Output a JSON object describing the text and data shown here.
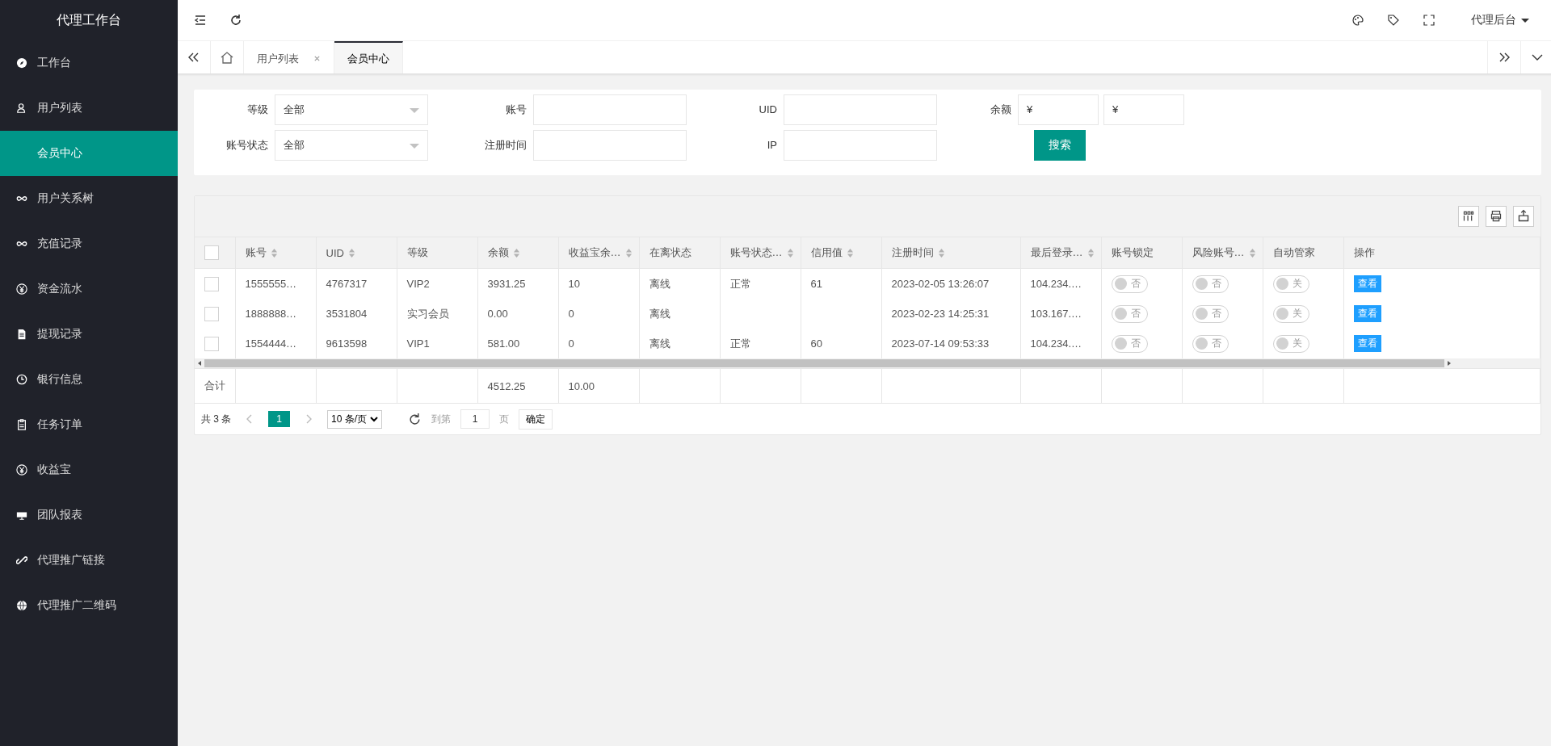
{
  "sidebar": {
    "title": "代理工作台",
    "items": [
      {
        "label": "工作台",
        "selected": false
      },
      {
        "label": "用户列表",
        "selected": false
      },
      {
        "label": "会员中心",
        "selected": true
      },
      {
        "label": "用户关系树",
        "selected": false
      },
      {
        "label": "充值记录",
        "selected": false
      },
      {
        "label": "资金流水",
        "selected": false
      },
      {
        "label": "提现记录",
        "selected": false
      },
      {
        "label": "银行信息",
        "selected": false
      },
      {
        "label": "任务订单",
        "selected": false
      },
      {
        "label": "收益宝",
        "selected": false
      },
      {
        "label": "团队报表",
        "selected": false
      },
      {
        "label": "代理推广链接",
        "selected": false
      },
      {
        "label": "代理推广二维码",
        "selected": false
      }
    ]
  },
  "topbar": {
    "user_menu": "代理后台"
  },
  "tabs": [
    {
      "label": "用户列表",
      "closable": true,
      "selected": false
    },
    {
      "label": "会员中心",
      "closable": false,
      "selected": true
    }
  ],
  "filters": [
    {
      "kind": "select",
      "label": "等级",
      "value": "全部"
    },
    {
      "kind": "input",
      "label": "账号"
    },
    {
      "kind": "input",
      "label": "UID"
    },
    {
      "kind": "range",
      "label": "余额",
      "prefix": "¥",
      "prefix_2": "¥"
    },
    {
      "kind": "select",
      "label": "账号状态",
      "value": "全部"
    },
    {
      "kind": "input",
      "label": "注册时间"
    },
    {
      "kind": "input",
      "label": "IP"
    },
    {
      "kind": "button",
      "label": "搜索"
    }
  ],
  "table": {
    "all_selected": false,
    "columns": [
      {
        "label": "账号",
        "sortable": true
      },
      {
        "label": "UID",
        "sortable": true
      },
      {
        "label": "等级",
        "sortable": false
      },
      {
        "label": "余额",
        "sortable": true
      },
      {
        "label": "收益宝余…",
        "sortable": true
      },
      {
        "label": "在离状态",
        "sortable": false
      },
      {
        "label": "账号状态…",
        "sortable": true
      },
      {
        "label": "信用值",
        "sortable": true
      },
      {
        "label": "注册时间",
        "sortable": true
      },
      {
        "label": "最后登录…",
        "sortable": true
      },
      {
        "label": "账号锁定",
        "sortable": false
      },
      {
        "label": "风险账号…",
        "sortable": true
      },
      {
        "label": "自动管家",
        "sortable": false
      },
      {
        "label": "操作",
        "sortable": false
      }
    ],
    "rows": [
      {
        "selected": false,
        "cells": [
          "1555555…",
          "4767317",
          "VIP2",
          "3931.25",
          "10",
          "离线",
          "正常",
          "61",
          "2023-02-05 13:26:07",
          "104.234.…"
        ],
        "switches": [
          {
            "label": "否",
            "on": false
          },
          {
            "label": "否",
            "on": false
          },
          {
            "label": "关",
            "on": false
          }
        ],
        "action": "查看"
      },
      {
        "selected": false,
        "cells": [
          "1888888…",
          "3531804",
          "实习会员",
          "0.00",
          "0",
          "离线",
          null,
          null,
          "2023-02-23 14:25:31",
          "103.167.…"
        ],
        "switches": [
          {
            "label": "否",
            "on": false
          },
          {
            "label": "否",
            "on": false
          },
          {
            "label": "关",
            "on": false
          }
        ],
        "action": "查看"
      },
      {
        "selected": false,
        "cells": [
          "1554444…",
          "9613598",
          "VIP1",
          "581.00",
          "0",
          "离线",
          "正常",
          "60",
          "2023-07-14 09:53:33",
          "104.234.…"
        ],
        "switches": [
          {
            "label": "否",
            "on": false
          },
          {
            "label": "否",
            "on": false
          },
          {
            "label": "关",
            "on": false
          }
        ],
        "action": "查看"
      }
    ],
    "totals": {
      "label": "合计",
      "cells": [
        null,
        null,
        null,
        "4512.25",
        "10.00"
      ]
    }
  },
  "pagination": {
    "total": "共 3 条",
    "current": "1",
    "page_size": "10 条/页",
    "goto_label": "到第",
    "goto_value": "1",
    "goto_unit": "页",
    "confirm": "确定"
  }
}
